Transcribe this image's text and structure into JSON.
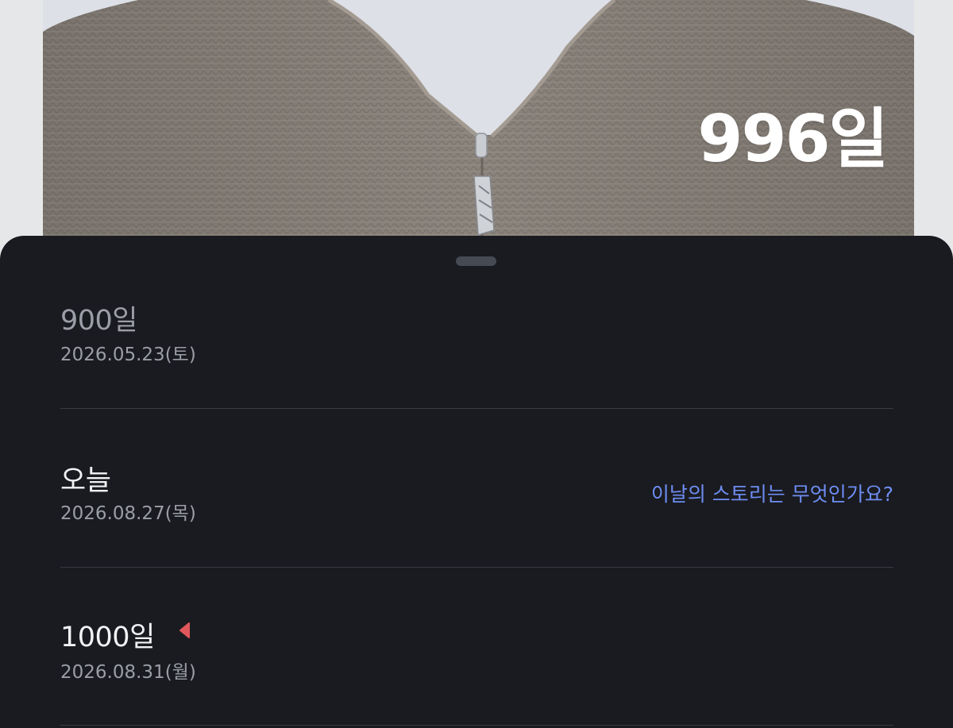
{
  "header": {
    "dday_count": "996일"
  },
  "milestones": {
    "past": {
      "title": "900일",
      "date": "2026.05.23(토)"
    },
    "today": {
      "title": "오늘",
      "date": "2026.08.27(목)",
      "story_prompt": "이날의 스토리는 무엇인가요?"
    },
    "next": {
      "title": "1000일",
      "date": "2026.08.31(월)",
      "marker_icon": "left-triangle-marker-icon"
    }
  },
  "colors": {
    "sheet_background": "#1a1b20",
    "link_accent": "#6d8df2",
    "marker_red": "#e0575b",
    "muted_text": "#9b9ea6"
  }
}
